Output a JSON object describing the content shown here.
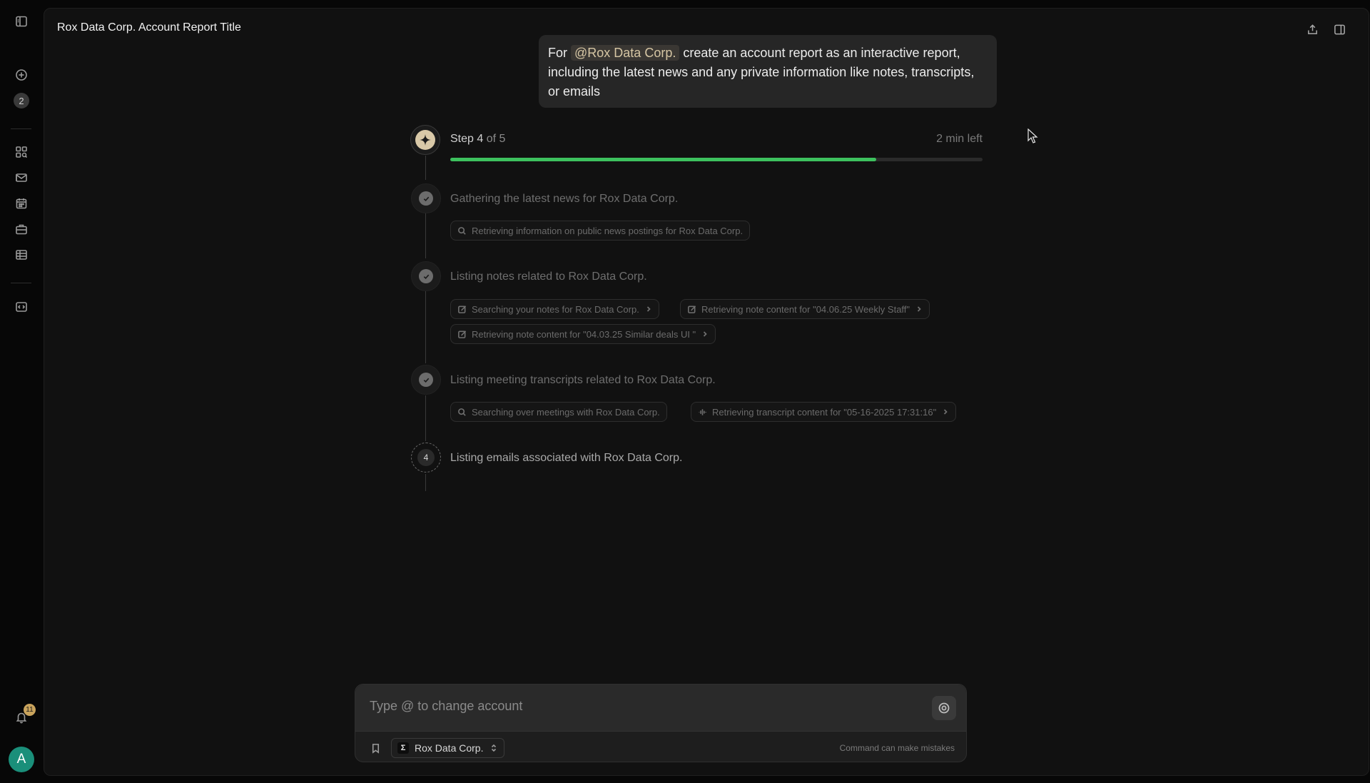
{
  "sidebar": {
    "counter": "2",
    "notification_count": "11",
    "avatar_initial": "A"
  },
  "header": {
    "title": "Rox Data Corp. Account Report Title"
  },
  "prompt": {
    "prefix": "For",
    "mention": "@Rox Data Corp.",
    "body": "create an account report as an interactive report, including the latest news and any private information like notes, transcripts, or emails"
  },
  "progress": {
    "step_word": "Step",
    "current": "4",
    "of_word": "of",
    "total": "5",
    "time_left": "2 min left",
    "fraction": 0.8,
    "color": "#3dc15e"
  },
  "steps": [
    {
      "title": "Gathering the latest news for Rox Data Corp.",
      "status": "done",
      "chips": [
        {
          "icon": "search-icon",
          "label": "Retrieving information on public news postings for Rox Data Corp."
        }
      ]
    },
    {
      "title": "Listing notes related to Rox Data Corp.",
      "status": "done",
      "chips": [
        {
          "icon": "edit-icon",
          "label": "Searching your notes for Rox Data Corp."
        },
        {
          "icon": "edit-icon",
          "label": "Retrieving note content for \"04.06.25 Weekly Staff\""
        },
        {
          "icon": "edit-icon",
          "label": "Retrieving note content for \"04.03.25 Similar deals UI \""
        }
      ]
    },
    {
      "title": "Listing meeting transcripts related to Rox Data Corp.",
      "status": "done",
      "chips": [
        {
          "icon": "search-icon",
          "label": "Searching over meetings with Rox Data Corp."
        },
        {
          "icon": "audio-icon",
          "label": "Retrieving transcript content for \"05-16-2025 17:31:16\""
        }
      ]
    },
    {
      "number": "4",
      "title": "Listing emails associated with Rox Data Corp.",
      "status": "in-progress"
    }
  ],
  "composer": {
    "placeholder": "Type @ to change account",
    "account": "Rox Data Corp.",
    "account_logo": "Σ",
    "disclaimer": "Command can make mistakes"
  }
}
